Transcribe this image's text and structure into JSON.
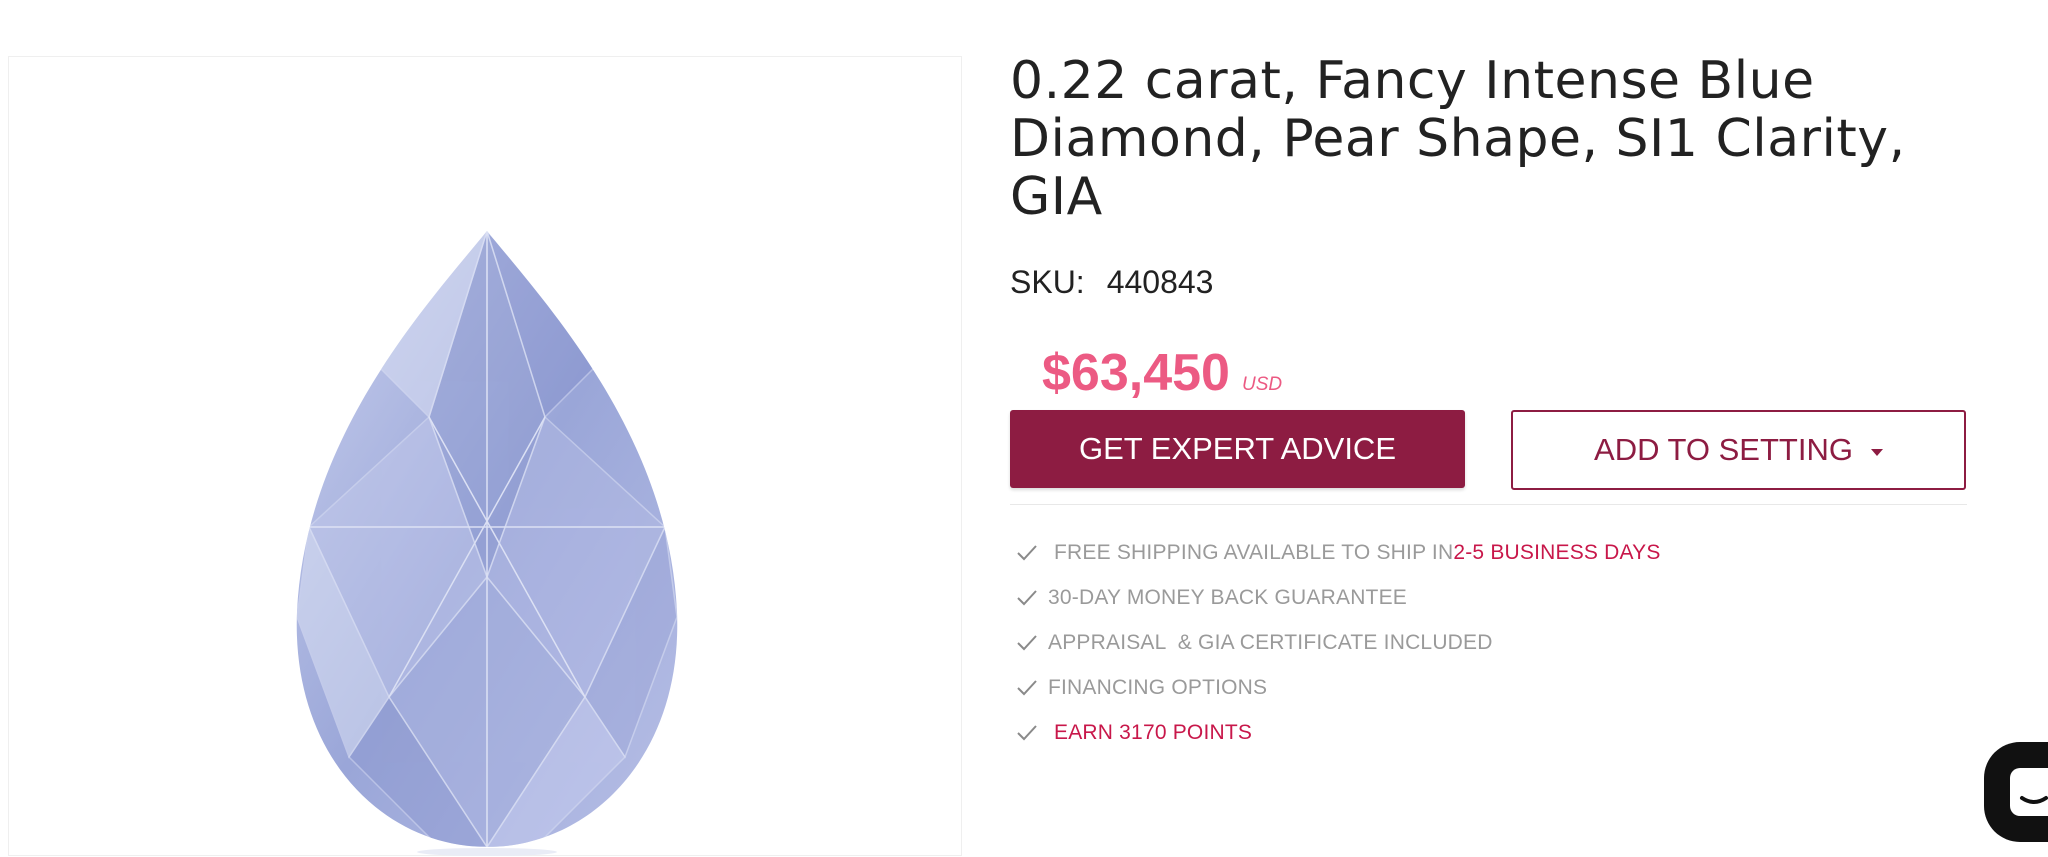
{
  "product": {
    "title": "0.22 carat, Fancy Intense Blue Diamond, Pear Shape, SI1 Clarity, GIA",
    "sku_label": "SKU:",
    "sku_value": "440843",
    "price": "$63,450",
    "currency": "USD"
  },
  "actions": {
    "expert_label": "GET EXPERT ADVICE",
    "setting_label": "ADD TO SETTING"
  },
  "benefits": {
    "shipping_prefix": "FREE SHIPPING AVAILABLE TO SHIP IN ",
    "shipping_days": "2-5 BUSINESS DAYS",
    "guarantee": "30-DAY MONEY BACK GUARANTEE",
    "appraisal": "APPRAISAL  & GIA CERTIFICATE INCLUDED",
    "financing": "FINANCING OPTIONS",
    "points": "EARN 3170 POINTS"
  },
  "icons": {
    "benefit": "check-icon",
    "chat": "chat-icon",
    "setting_caret": "caret-down-icon"
  },
  "colors": {
    "brand": "#8d1c42",
    "price": "#ec5a83",
    "accent": "#c8174a",
    "muted": "#9a9a9a"
  }
}
